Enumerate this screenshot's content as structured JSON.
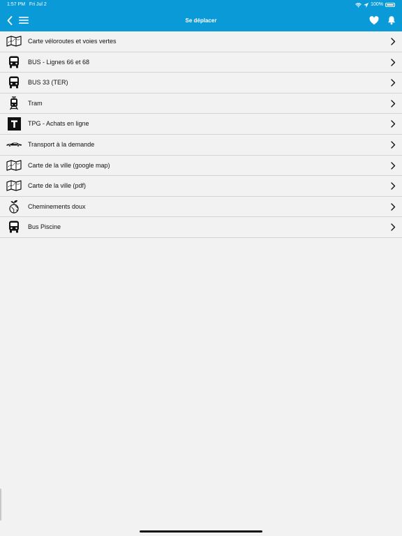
{
  "status": {
    "time": "1:57 PM",
    "date": "Fri Jul 2",
    "battery": "100%"
  },
  "nav": {
    "title": "Se déplacer",
    "back_icon": "chevron-left-icon",
    "menu_icon": "hamburger-menu-icon",
    "favorite_icon": "heart-icon",
    "notification_icon": "bell-icon"
  },
  "colors": {
    "accent": "#0a9ad8",
    "background": "#f2f2f2",
    "divider": "#d4d4d4"
  },
  "items": [
    {
      "label": "Carte véloroutes et voies vertes",
      "icon": "map-icon"
    },
    {
      "label": "BUS - Lignes 66 et 68",
      "icon": "bus-icon"
    },
    {
      "label": "BUS 33 (TER)",
      "icon": "bus-icon"
    },
    {
      "label": "Tram",
      "icon": "tram-icon"
    },
    {
      "label": "TPG - Achats en ligne",
      "icon": "tpg-t-icon"
    },
    {
      "label": "Transport à la demande",
      "icon": "car-icon"
    },
    {
      "label": "Carte de la ville (google map)",
      "icon": "map-icon"
    },
    {
      "label": "Carte de la ville (pdf)",
      "icon": "map-icon"
    },
    {
      "label": "Cheminements doux",
      "icon": "eco-globe-icon"
    },
    {
      "label": "Bus Piscine",
      "icon": "bus-icon"
    }
  ]
}
